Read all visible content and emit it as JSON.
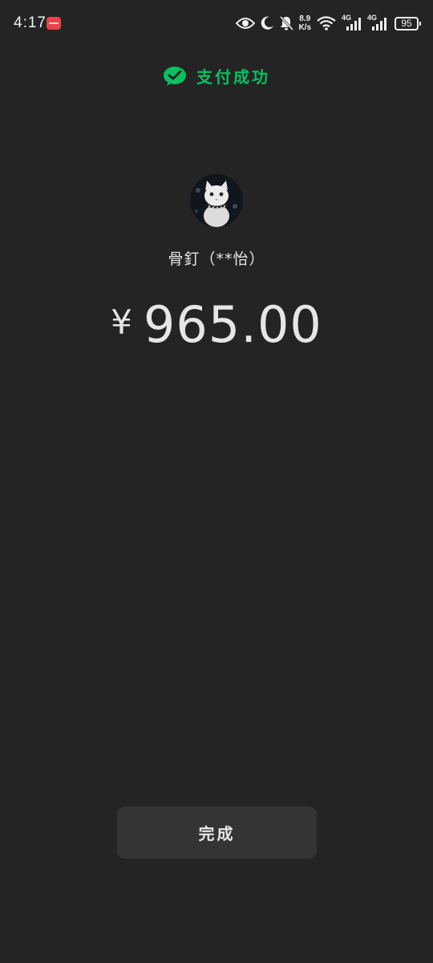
{
  "status_bar": {
    "time": "4:17",
    "net_speed_value": "8.9",
    "net_speed_unit": "K/s",
    "sim1_label": "4G",
    "sim2_label": "4G",
    "battery": "95"
  },
  "header": {
    "title": "支付成功"
  },
  "payee": {
    "name": "骨釘（**怡）"
  },
  "payment": {
    "currency_symbol": "¥",
    "amount": "965.00"
  },
  "actions": {
    "done_label": "完成"
  },
  "colors": {
    "background": "#242424",
    "accent_green": "#07c160",
    "button_bg": "#343434"
  },
  "icons": {
    "status": [
      "eye-icon",
      "moon-icon",
      "bell-off-icon",
      "wifi-icon",
      "signal-icon",
      "battery-icon"
    ],
    "header": "wechat-pay-icon"
  }
}
